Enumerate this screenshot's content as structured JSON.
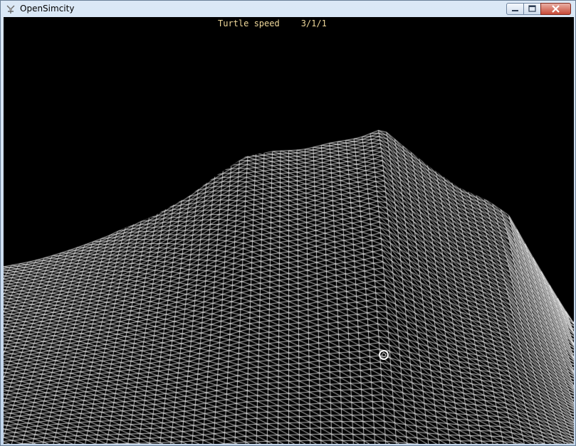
{
  "window": {
    "title": "OpenSimcity",
    "icons": {
      "app": "app-icon",
      "minimize": "minimize-icon",
      "maximize": "maximize-icon",
      "close": "close-icon"
    }
  },
  "hud": {
    "label": "Turtle speed",
    "value": "3/1/1"
  },
  "colors": {
    "viewport_background": "#000000",
    "mesh": "#ffffff",
    "hud_text": "#efd89a",
    "close_button": "#c84a38"
  }
}
